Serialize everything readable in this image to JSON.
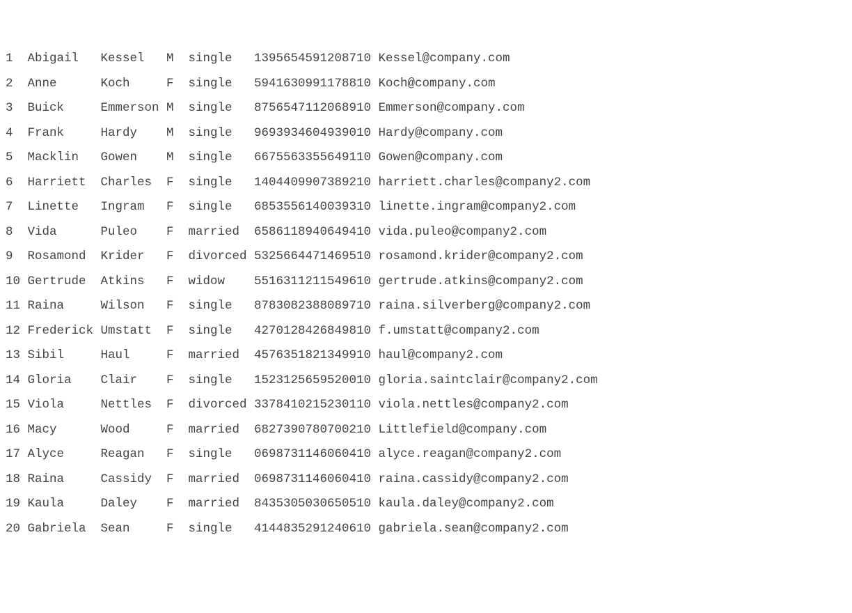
{
  "rows": [
    {
      "idx": "1",
      "first": "Abigail",
      "last": "Kessel",
      "sex": "M",
      "status": "single",
      "number": "1395654591208710",
      "email": "Kessel@company.com"
    },
    {
      "idx": "2",
      "first": "Anne",
      "last": "Koch",
      "sex": "F",
      "status": "single",
      "number": "5941630991178810",
      "email": "Koch@company.com"
    },
    {
      "idx": "3",
      "first": "Buick",
      "last": "Emmerson",
      "sex": "M",
      "status": "single",
      "number": "8756547112068910",
      "email": "Emmerson@company.com"
    },
    {
      "idx": "4",
      "first": "Frank",
      "last": "Hardy",
      "sex": "M",
      "status": "single",
      "number": "9693934604939010",
      "email": "Hardy@company.com"
    },
    {
      "idx": "5",
      "first": "Macklin",
      "last": "Gowen",
      "sex": "M",
      "status": "single",
      "number": "6675563355649110",
      "email": "Gowen@company.com"
    },
    {
      "idx": "6",
      "first": "Harriett",
      "last": "Charles",
      "sex": "F",
      "status": "single",
      "number": "1404409907389210",
      "email": "harriett.charles@company2.com"
    },
    {
      "idx": "7",
      "first": "Linette",
      "last": "Ingram",
      "sex": "F",
      "status": "single",
      "number": "6853556140039310",
      "email": "linette.ingram@company2.com"
    },
    {
      "idx": "8",
      "first": "Vida",
      "last": "Puleo",
      "sex": "F",
      "status": "married",
      "number": "6586118940649410",
      "email": "vida.puleo@company2.com"
    },
    {
      "idx": "9",
      "first": "Rosamond",
      "last": "Krider",
      "sex": "F",
      "status": "divorced",
      "number": "5325664471469510",
      "email": "rosamond.krider@company2.com"
    },
    {
      "idx": "10",
      "first": "Gertrude",
      "last": "Atkins",
      "sex": "F",
      "status": "widow",
      "number": "5516311211549610",
      "email": "gertrude.atkins@company2.com"
    },
    {
      "idx": "11",
      "first": "Raina",
      "last": "Wilson",
      "sex": "F",
      "status": "single",
      "number": "8783082388089710",
      "email": "raina.silverberg@company2.com"
    },
    {
      "idx": "12",
      "first": "Frederick",
      "last": "Umstatt",
      "sex": "F",
      "status": "single",
      "number": "4270128426849810",
      "email": "f.umstatt@company2.com"
    },
    {
      "idx": "13",
      "first": "Sibil",
      "last": "Haul",
      "sex": "F",
      "status": "married",
      "number": "4576351821349910",
      "email": "haul@company2.com"
    },
    {
      "idx": "14",
      "first": "Gloria",
      "last": "Clair",
      "sex": "F",
      "status": "single",
      "number": "1523125659520010",
      "email": "gloria.saintclair@company2.com"
    },
    {
      "idx": "15",
      "first": "Viola",
      "last": "Nettles",
      "sex": "F",
      "status": "divorced",
      "number": "3378410215230110",
      "email": "viola.nettles@company2.com"
    },
    {
      "idx": "16",
      "first": "Macy",
      "last": "Wood",
      "sex": "F",
      "status": "married",
      "number": "6827390780700210",
      "email": "Littlefield@company.com"
    },
    {
      "idx": "17",
      "first": "Alyce",
      "last": "Reagan",
      "sex": "F",
      "status": "single",
      "number": "0698731146060410",
      "email": "alyce.reagan@company2.com"
    },
    {
      "idx": "18",
      "first": "Raina",
      "last": "Cassidy",
      "sex": "F",
      "status": "married",
      "number": "0698731146060410",
      "email": "raina.cassidy@company2.com"
    },
    {
      "idx": "19",
      "first": "Kaula",
      "last": "Daley",
      "sex": "F",
      "status": "married",
      "number": "8435305030650510",
      "email": "kaula.daley@company2.com"
    },
    {
      "idx": "20",
      "first": "Gabriela",
      "last": "Sean",
      "sex": "F",
      "status": "single",
      "number": "4144835291240610",
      "email": "gabriela.sean@company2.com"
    }
  ]
}
